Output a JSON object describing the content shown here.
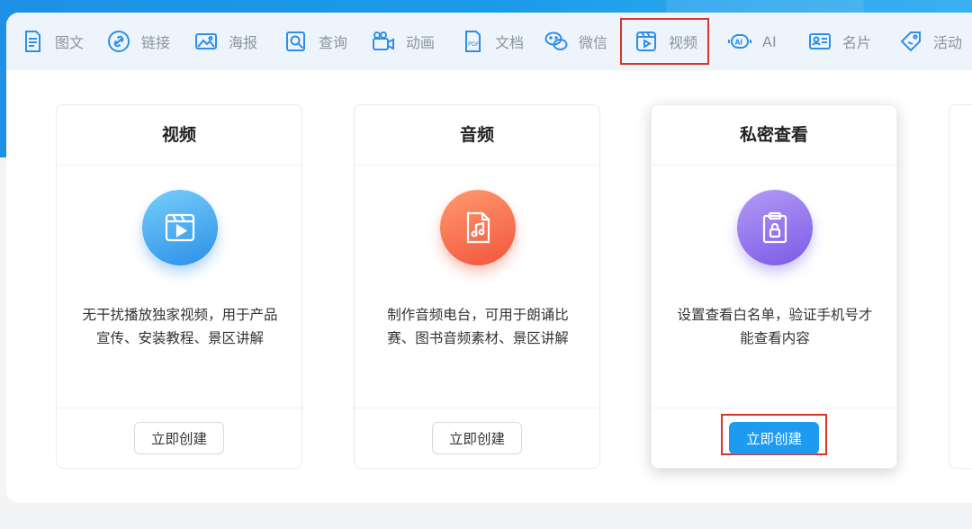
{
  "nav": {
    "items": [
      {
        "label": "图文",
        "icon": "document-icon"
      },
      {
        "label": "链接",
        "icon": "link-icon"
      },
      {
        "label": "海报",
        "icon": "image-icon"
      },
      {
        "label": "查询",
        "icon": "search-icon"
      },
      {
        "label": "动画",
        "icon": "video-camera-icon"
      },
      {
        "label": "文档",
        "icon": "pdf-icon"
      },
      {
        "label": "微信",
        "icon": "wechat-icon"
      },
      {
        "label": "视频",
        "icon": "video-icon"
      },
      {
        "label": "AI",
        "icon": "ai-icon"
      },
      {
        "label": "名片",
        "icon": "business-card-icon"
      },
      {
        "label": "活动",
        "icon": "tag-icon"
      }
    ],
    "active_index": 7
  },
  "cards": [
    {
      "title": "视频",
      "icon": "video-icon",
      "description": "无干扰播放独家视频，用于产品宣传、安装教程、景区讲解",
      "button": "立即创建"
    },
    {
      "title": "音频",
      "icon": "music-file-icon",
      "description": "制作音频电台，可用于朗诵比赛、图书音频素材、景区讲解",
      "button": "立即创建"
    },
    {
      "title": "私密查看",
      "icon": "locked-clipboard-icon",
      "description": "设置查看白名单，验证手机号才能查看内容",
      "button": "立即创建"
    }
  ],
  "colors": {
    "accent": "#1e9bf0",
    "highlight_frame": "#d9342b",
    "nav_text": "#8a94a2"
  }
}
